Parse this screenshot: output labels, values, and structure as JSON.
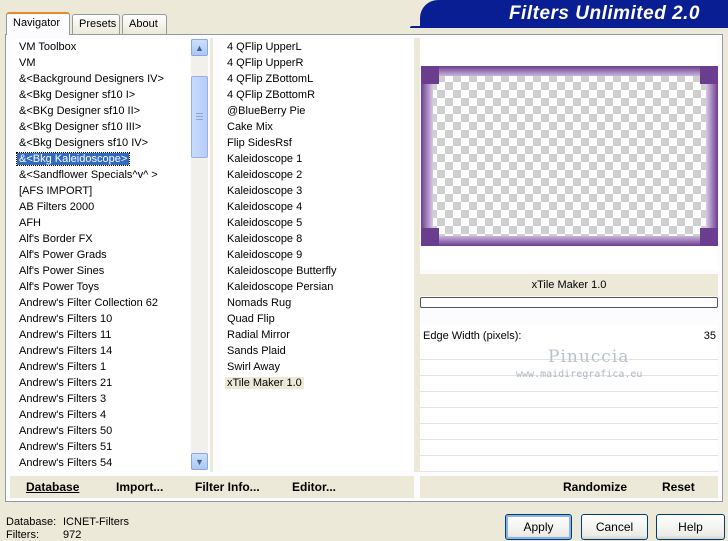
{
  "tabs": [
    {
      "label": "Navigator",
      "active": true
    },
    {
      "label": "Presets",
      "active": false
    },
    {
      "label": "About",
      "active": false
    }
  ],
  "banner": {
    "title": "Filters Unlimited 2.0"
  },
  "categories": {
    "items": [
      "VM Toolbox",
      "VM",
      "&<Background Designers IV>",
      "&<Bkg Designer sf10 I>",
      "&<BKg Designer sf10 II>",
      "&<Bkg Designer sf10 III>",
      "&<Bkg Designers sf10 IV>",
      "&<Bkg Kaleidoscope>",
      "&<Sandflower Specials^v^ >",
      "[AFS IMPORT]",
      "AB Filters 2000",
      "AFH",
      "Alf's Border FX",
      "Alf's Power Grads",
      "Alf's Power Sines",
      "Alf's Power Toys",
      "Andrew's Filter Collection 62",
      "Andrew's Filters 10",
      "Andrew's Filters 11",
      "Andrew's Filters 14",
      "Andrew's Filters 1",
      "Andrew's Filters 21",
      "Andrew's Filters 3",
      "Andrew's Filters 4",
      "Andrew's Filters 50",
      "Andrew's Filters 51",
      "Andrew's Filters 54"
    ],
    "selected_index": 7
  },
  "filters": {
    "items": [
      "4 QFlip UpperL",
      "4 QFlip UpperR",
      "4 QFlip ZBottomL",
      "4 QFlip ZBottomR",
      "@BlueBerry Pie",
      "Cake Mix",
      "Flip SidesRsf",
      "Kaleidoscope 1",
      "Kaleidoscope 2",
      "Kaleidoscope 3",
      "Kaleidoscope 4",
      "Kaleidoscope 5",
      "Kaleidoscope 8",
      "Kaleidoscope 9",
      "Kaleidoscope Butterfly",
      "Kaleidoscope Persian",
      "Nomads Rug",
      "Quad Flip",
      "Radial Mirror",
      "Sands Plaid",
      "Swirl Away",
      "xTile Maker 1.0"
    ],
    "selected_index": 21
  },
  "preview": {
    "filter_name": "xTile Maker 1.0",
    "frame_color": "#6a3d8f",
    "progress_fraction": 0
  },
  "parameters": [
    {
      "label": "Edge Width (pixels):",
      "value": "35"
    }
  ],
  "watermark": {
    "line1": "Pinuccia",
    "line2": "www.maidiregrafica.eu"
  },
  "bottom_buttons": {
    "database": "Database",
    "import": "Import...",
    "filter_info": "Filter Info...",
    "editor": "Editor...",
    "randomize": "Randomize",
    "reset": "Reset"
  },
  "footer": {
    "database_label": "Database:",
    "database_value": "ICNET-Filters",
    "filters_label": "Filters:",
    "filters_value": "972"
  },
  "dialog_buttons": {
    "apply": "Apply",
    "cancel": "Cancel",
    "help": "Help"
  }
}
